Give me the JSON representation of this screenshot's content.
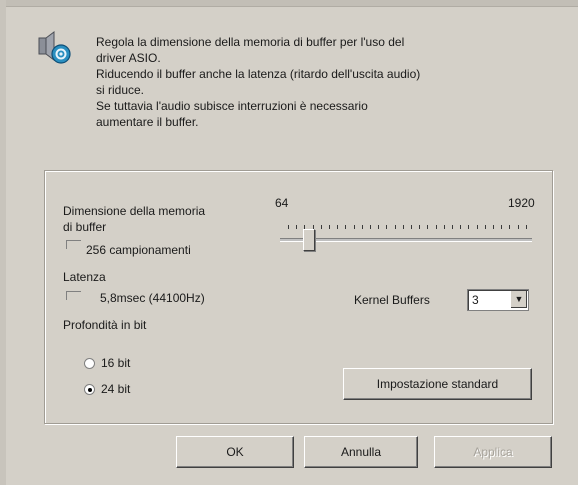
{
  "dialog": {
    "intro_line1": "Regola la dimensione della memoria di buffer per l'uso del",
    "intro_line2": "driver ASIO.",
    "intro_line3": "Riducendo il buffer anche la latenza (ritardo dell'uscita audio)",
    "intro_line4": "si riduce.",
    "intro_line5": "Se tuttavia l'audio subisce interruzioni è necessario",
    "intro_line6": "aumentare il buffer.",
    "icon": "speaker-settings-icon"
  },
  "buffer": {
    "label_line1": "Dimensione della memoria",
    "label_line2": "di buffer",
    "value_text": "256 campionamenti",
    "slider_min": "64",
    "slider_max": "1920",
    "slider_value": 256
  },
  "latency": {
    "label": "Latenza",
    "value_text": "5,8msec (44100Hz)"
  },
  "kernel": {
    "label": "Kernel Buffers",
    "value": "3"
  },
  "bitdepth": {
    "label": "Profondità in bit",
    "options": [
      "16 bit",
      "24 bit"
    ],
    "selected": "24 bit"
  },
  "buttons": {
    "standard": "Impostazione standard",
    "ok": "OK",
    "cancel": "Annulla",
    "apply": "Applica"
  }
}
